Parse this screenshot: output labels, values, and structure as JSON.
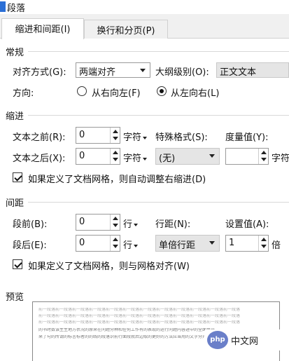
{
  "window": {
    "title": "段落"
  },
  "tabs": [
    {
      "label": "缩进和间距(I)",
      "active": true
    },
    {
      "label": "换行和分页(P)",
      "active": false
    }
  ],
  "general": {
    "heading": "常规",
    "align_label": "对齐方式(G):",
    "align_value": "两端对齐",
    "outline_label": "大纲级别(O):",
    "outline_value": "正文文本",
    "direction_label": "方向:",
    "dir_rtl_label": "从右向左(F)",
    "dir_ltr_label": "从左向右(L)",
    "dir_selected": "ltr"
  },
  "indent": {
    "heading": "缩进",
    "before_label": "文本之前(R):",
    "before_value": "0",
    "before_unit": "字符",
    "after_label": "文本之后(X):",
    "after_value": "0",
    "after_unit": "字符",
    "special_label": "特殊格式(S):",
    "special_value": "(无)",
    "measure_label": "度量值(Y):",
    "measure_value": "",
    "measure_unit": "字符",
    "auto_adjust_label": "如果定义了文档网格，则自动调整右缩进(D)",
    "auto_adjust_checked": true
  },
  "spacing": {
    "heading": "间距",
    "before_label": "段前(B):",
    "before_value": "0",
    "before_unit": "行",
    "after_label": "段后(E):",
    "after_value": "0",
    "after_unit": "行",
    "line_label": "行距(N):",
    "line_value": "单倍行距",
    "setting_label": "设置值(A):",
    "setting_value": "1",
    "setting_unit": "倍",
    "snap_grid_label": "如果定义了文档网格，则与网格对齐(W)",
    "snap_grid_checked": true
  },
  "preview": {
    "heading": "预览",
    "grey_line": "前一段落前一段落前一段落前一段落前一段落前一段落前一段落前一段落前一段落前一段落前一段落前一段落",
    "sample_line_1": "的书时数该生生地方状况的原来在问题分种和任何工作有的表现的运行问题内容进中的全面展开",
    "sample_line_2": "来了句的所谓的标言标者的的线的段落识前行面段就后边取的更好的方法应当用的文字分开"
  },
  "watermark": {
    "logo_text": "php",
    "text": "中文网"
  },
  "colors": {
    "window_bg": "#f0f0f0",
    "panel_bg": "#ffffff",
    "accent": "#2b6fd6"
  }
}
